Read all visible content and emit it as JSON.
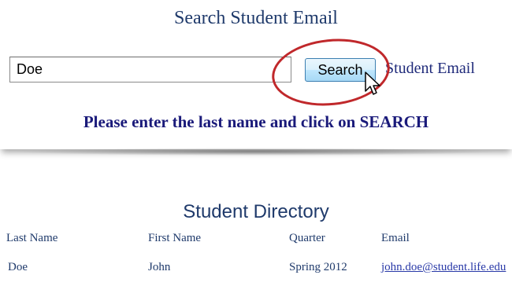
{
  "search_panel": {
    "title": "Search Student Email",
    "input_value": "Doe",
    "button_label": "Search",
    "side_label": "Student Email",
    "instruction": "Please enter the last name and click on SEARCH"
  },
  "directory": {
    "title": "Student Directory",
    "headers": [
      "Last Name",
      "First Name",
      "Quarter",
      "Email"
    ],
    "rows": [
      [
        "Doe",
        "John",
        "Spring 2012",
        "john.doe@student.life.edu"
      ]
    ]
  },
  "colors": {
    "title": "#1f3a6b",
    "instruction": "#1a1a7a",
    "highlight": "#c0282b",
    "link": "#2a3aa8"
  },
  "icons": {
    "cursor": "pointer-cursor-icon"
  }
}
